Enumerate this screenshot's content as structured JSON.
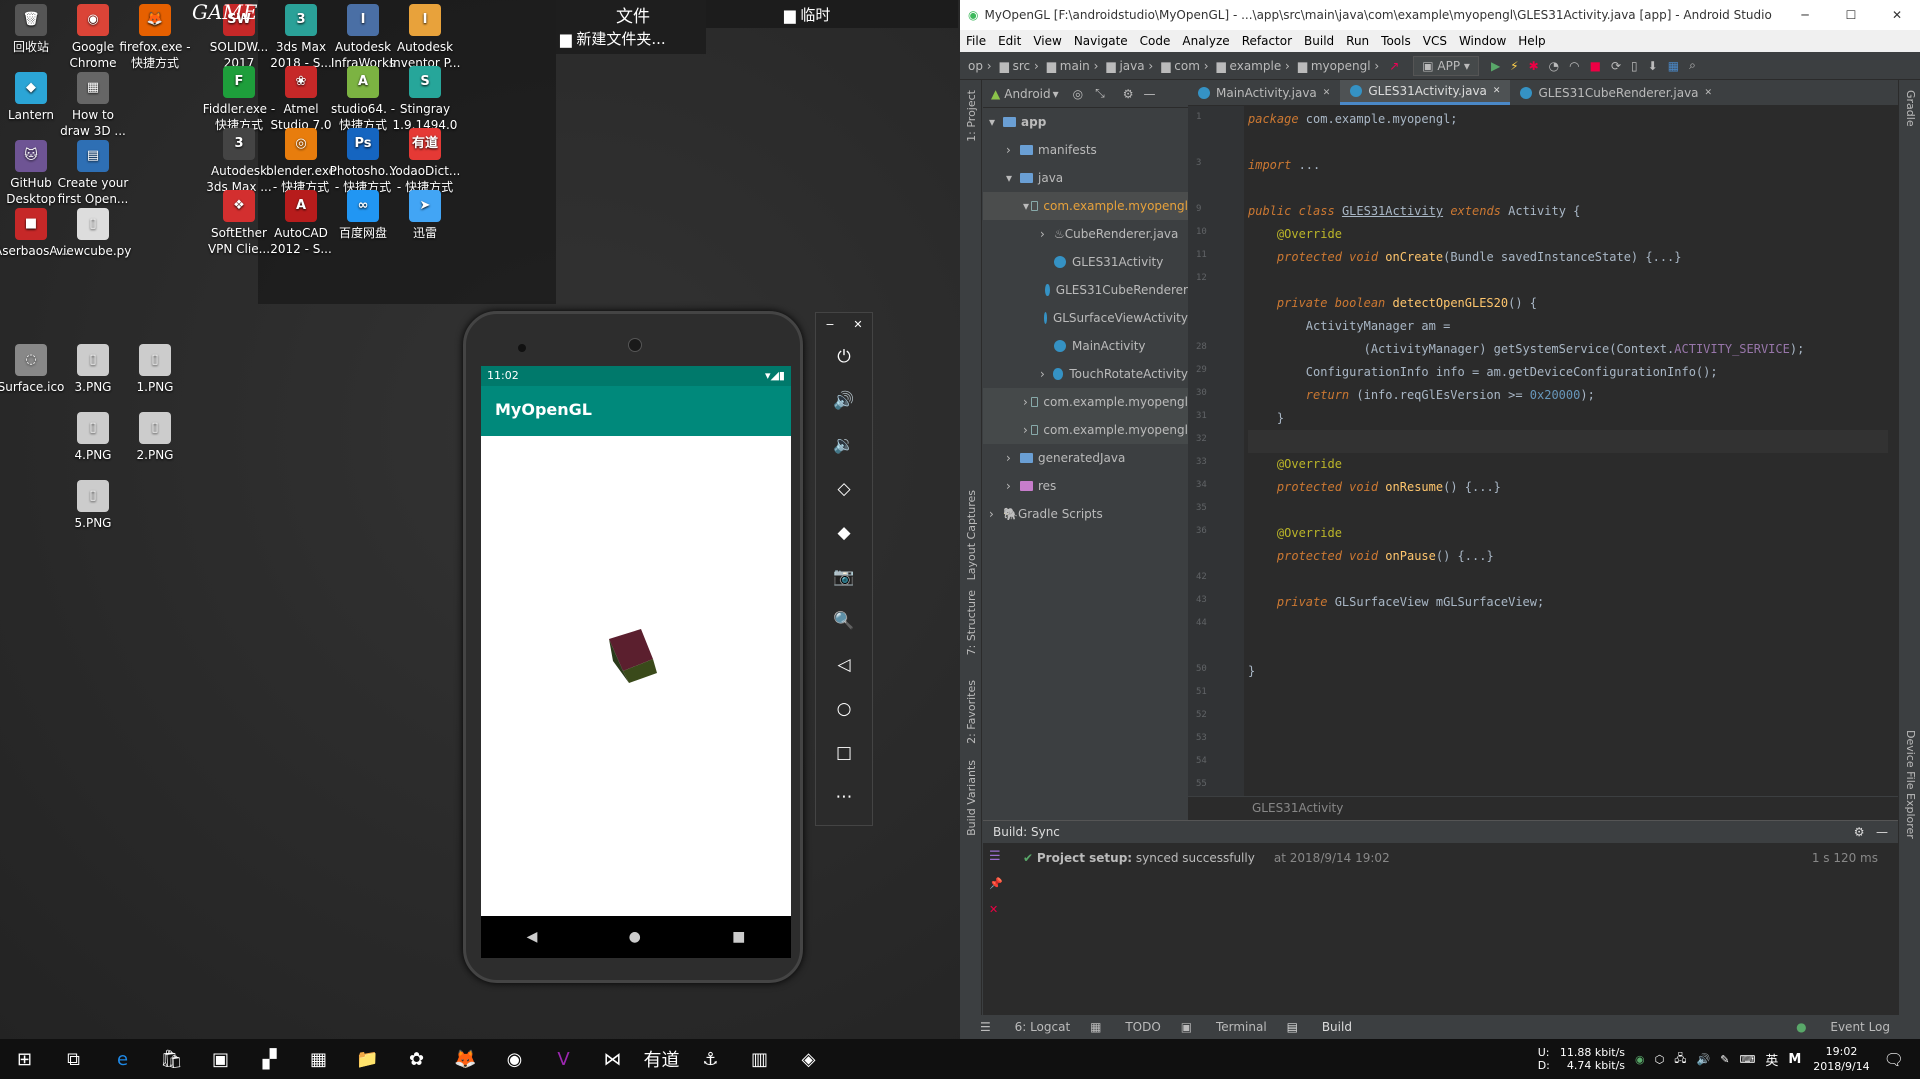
{
  "desktop": {
    "icons": [
      {
        "label": "回收站",
        "glyph": "🗑",
        "color": "#555"
      },
      {
        "label": "Google Chrome",
        "glyph": "◉",
        "color": "#db4437"
      },
      {
        "label": "firefox.exe - 快捷方式",
        "glyph": "🦊",
        "color": "#e66000"
      },
      {
        "label": "Lantern",
        "glyph": "◆",
        "color": "#2ba5d6"
      },
      {
        "label": "How to draw 3D ...",
        "glyph": "▦",
        "color": "#666"
      },
      {
        "label": "GitHub Desktop",
        "glyph": "🐱",
        "color": "#6e5494"
      },
      {
        "label": "Create your first Open...",
        "glyph": "▤",
        "color": "#2e6fb4"
      },
      {
        "label": "AserbaosA...",
        "glyph": "■",
        "color": "#c62828"
      },
      {
        "label": "viewcube.py",
        "glyph": "▯",
        "color": "#ddd"
      },
      {
        "label": "SOLIDW... 2017",
        "glyph": "SW",
        "color": "#c62828"
      },
      {
        "label": "3ds Max 2018 - S...",
        "glyph": "3",
        "color": "#2aa198"
      },
      {
        "label": "Autodesk InfraWorks",
        "glyph": "I",
        "color": "#4a6fa5"
      },
      {
        "label": "Autodesk Inventor P...",
        "glyph": "I",
        "color": "#e8a23b"
      },
      {
        "label": "Fiddler.exe - 快捷方式",
        "glyph": "F",
        "color": "#1e9e3b"
      },
      {
        "label": "Atmel Studio 7.0",
        "glyph": "❀",
        "color": "#c62828"
      },
      {
        "label": "studio64. - 快捷方式",
        "glyph": "A",
        "color": "#7cb342"
      },
      {
        "label": "Stingray 1.9.1494.0",
        "glyph": "S",
        "color": "#26a69a"
      },
      {
        "label": "Autodesk 3ds Max ...",
        "glyph": "3",
        "color": "#444"
      },
      {
        "label": "blender.exe - 快捷方式",
        "glyph": "◎",
        "color": "#e87d0d"
      },
      {
        "label": "Photosho... - 快捷方式",
        "glyph": "Ps",
        "color": "#1565c0"
      },
      {
        "label": "YodaoDict... - 快捷方式",
        "glyph": "有道",
        "color": "#e53935"
      },
      {
        "label": "SoftEther VPN Clie...",
        "glyph": "❖",
        "color": "#d32f2f"
      },
      {
        "label": "AutoCAD 2012 - S...",
        "glyph": "A",
        "color": "#b71c1c"
      },
      {
        "label": "百度网盘",
        "glyph": "∞",
        "color": "#2196f3"
      },
      {
        "label": "迅雷",
        "glyph": "➤",
        "color": "#42a5f5"
      },
      {
        "label": "Surface.ico",
        "glyph": "◌",
        "color": "#888"
      },
      {
        "label": "3.PNG",
        "glyph": "▯",
        "color": "#ccc"
      },
      {
        "label": "1.PNG",
        "glyph": "▯",
        "color": "#ccc"
      },
      {
        "label": "4.PNG",
        "glyph": "▯",
        "color": "#ccc"
      },
      {
        "label": "2.PNG",
        "glyph": "▯",
        "color": "#ccc"
      },
      {
        "label": "5.PNG",
        "glyph": "▯",
        "color": "#ccc"
      }
    ],
    "notes": {
      "game": "GAME",
      "folder1": "文件",
      "folder2": "新建文件夹...",
      "folder3": "临时"
    }
  },
  "phone": {
    "time": "11:02",
    "app_title": "MyOpenGL",
    "nav": [
      "◀",
      "●",
      "■"
    ]
  },
  "emulator_controls": [
    "⏻",
    "🔊",
    "🔉",
    "◇",
    "◆",
    "📷",
    "🔍",
    "◁",
    "○",
    "□",
    "⋯"
  ],
  "ide": {
    "title": "MyOpenGL [F:\\androidstudio\\MyOpenGL] - ...\\app\\src\\main\\java\\com\\example\\myopengl\\GLES31Activity.java [app] - Android Studio",
    "menu": [
      "File",
      "Edit",
      "View",
      "Navigate",
      "Code",
      "Analyze",
      "Refactor",
      "Build",
      "Run",
      "Tools",
      "VCS",
      "Window",
      "Help"
    ],
    "breadcrumbs": [
      "op",
      "src",
      "main",
      "java",
      "com",
      "example",
      "myopengl"
    ],
    "run_config": "APP",
    "project_view": "Android",
    "tree": [
      {
        "label": "app",
        "indent": 0,
        "arrow": "▾",
        "kind": "folder"
      },
      {
        "label": "manifests",
        "indent": 1,
        "arrow": "›",
        "kind": "folder"
      },
      {
        "label": "java",
        "indent": 1,
        "arrow": "▾",
        "kind": "folder"
      },
      {
        "label": "com.example.myopengl",
        "indent": 2,
        "arrow": "▾",
        "kind": "pkg",
        "sel": true
      },
      {
        "label": "CubeRenderer.java",
        "indent": 3,
        "arrow": "›",
        "kind": "java"
      },
      {
        "label": "GLES31Activity",
        "indent": 3,
        "arrow": "",
        "kind": "class"
      },
      {
        "label": "GLES31CubeRenderer",
        "indent": 3,
        "arrow": "",
        "kind": "class"
      },
      {
        "label": "GLSurfaceViewActivity",
        "indent": 3,
        "arrow": "",
        "kind": "class"
      },
      {
        "label": "MainActivity",
        "indent": 3,
        "arrow": "",
        "kind": "class"
      },
      {
        "label": "TouchRotateActivity",
        "indent": 3,
        "arrow": "›",
        "kind": "class"
      },
      {
        "label": "com.example.myopengl",
        "indent": 2,
        "arrow": "›",
        "kind": "pkg",
        "hl": true
      },
      {
        "label": "com.example.myopengl",
        "indent": 2,
        "arrow": "›",
        "kind": "pkg",
        "hl": true
      },
      {
        "label": "generatedJava",
        "indent": 1,
        "arrow": "›",
        "kind": "folder"
      },
      {
        "label": "res",
        "indent": 1,
        "arrow": "›",
        "kind": "folder"
      },
      {
        "label": "Gradle Scripts",
        "indent": 0,
        "arrow": "›",
        "kind": "gradle"
      }
    ],
    "tabs": [
      {
        "label": "MainActivity.java",
        "active": false
      },
      {
        "label": "GLES31Activity.java",
        "active": true
      },
      {
        "label": "GLES31CubeRenderer.java",
        "active": false
      }
    ],
    "line_numbers": [
      "1",
      "",
      "3",
      "",
      "9",
      "10",
      "11",
      "12",
      "",
      "",
      "28",
      "29",
      "30",
      "31",
      "32",
      "33",
      "34",
      "35",
      "36",
      "",
      "42",
      "43",
      "44",
      "",
      "50",
      "51",
      "52",
      "53",
      "54",
      "55"
    ],
    "code_breadcrumb": "GLES31Activity",
    "build_tab": "Build: Sync",
    "build_status_bold": "Project setup:",
    "build_status": "synced successfully",
    "build_time": "at 2018/9/14 19:02",
    "build_duration": "1 s 120 ms",
    "left_tools": [
      "1: Project",
      "Layout Captures",
      "7: Structure",
      "2: Favorites",
      "Build Variants"
    ],
    "right_tools": [
      "Gradle",
      "Device File Explorer"
    ],
    "bottom_tabs": [
      "6: Logcat",
      "TODO",
      "Terminal",
      "Build"
    ],
    "event_log": "Event Log"
  },
  "taskbar": {
    "apps": [
      "⊞",
      "⧉",
      "e",
      "🛍",
      "▣",
      "▞",
      "▦",
      "📁",
      "✿",
      "🦊",
      "◉",
      "V",
      "⋈",
      "有道",
      "⚓",
      "▥",
      "◈"
    ],
    "net_up": "11.88 kbit/s",
    "net_down": "4.74 kbit/s",
    "net_u_label": "U:",
    "net_d_label": "D:",
    "ime": "英",
    "ime2": "M",
    "time": "19:02",
    "date": "2018/9/14"
  }
}
